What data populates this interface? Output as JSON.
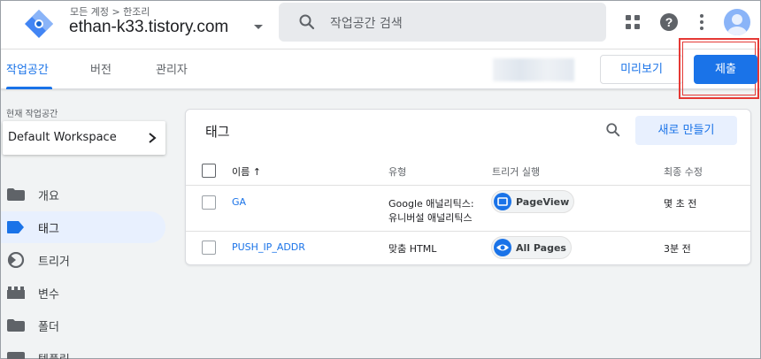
{
  "header": {
    "account_path": "모든 계정 > 한조리",
    "container_name": "ethan-k33.tistory.com",
    "search_placeholder": "작업공간 검색"
  },
  "tabs": [
    {
      "label": "작업공간",
      "active": true
    },
    {
      "label": "버전",
      "active": false
    },
    {
      "label": "관리자",
      "active": false
    }
  ],
  "toolbar": {
    "preview_label": "미리보기",
    "submit_label": "제출"
  },
  "sidebar": {
    "workspace_label": "현재 작업공간",
    "workspace_name": "Default Workspace",
    "items": [
      {
        "label": "개요",
        "icon": "folder-icon"
      },
      {
        "label": "태그",
        "icon": "tag-icon",
        "active": true
      },
      {
        "label": "트리거",
        "icon": "trigger-icon"
      },
      {
        "label": "변수",
        "icon": "variable-icon"
      },
      {
        "label": "폴더",
        "icon": "folder-icon"
      },
      {
        "label": "템플릿",
        "icon": "template-icon"
      }
    ]
  },
  "tags_card": {
    "title": "태그",
    "new_button": "새로 만들기",
    "columns": [
      "이름 ↑",
      "유형",
      "트리거 실행",
      "최종 수정"
    ],
    "rows": [
      {
        "name": "GA",
        "type_line1": "Google 애널리틱스:",
        "type_line2": "유니버설 애널리틱스",
        "trigger": "PageView",
        "trigger_icon": "pageview-icon",
        "modified": "몇 초 전"
      },
      {
        "name": "PUSH_IP_ADDR",
        "type_line1": "맞춤 HTML",
        "type_line2": "",
        "trigger": "All Pages",
        "trigger_icon": "eye-icon",
        "modified": "3분 전"
      }
    ]
  },
  "colors": {
    "accent": "#1a73e8",
    "highlight": "#e53935",
    "active_nav_bg": "#e8f0fe"
  }
}
